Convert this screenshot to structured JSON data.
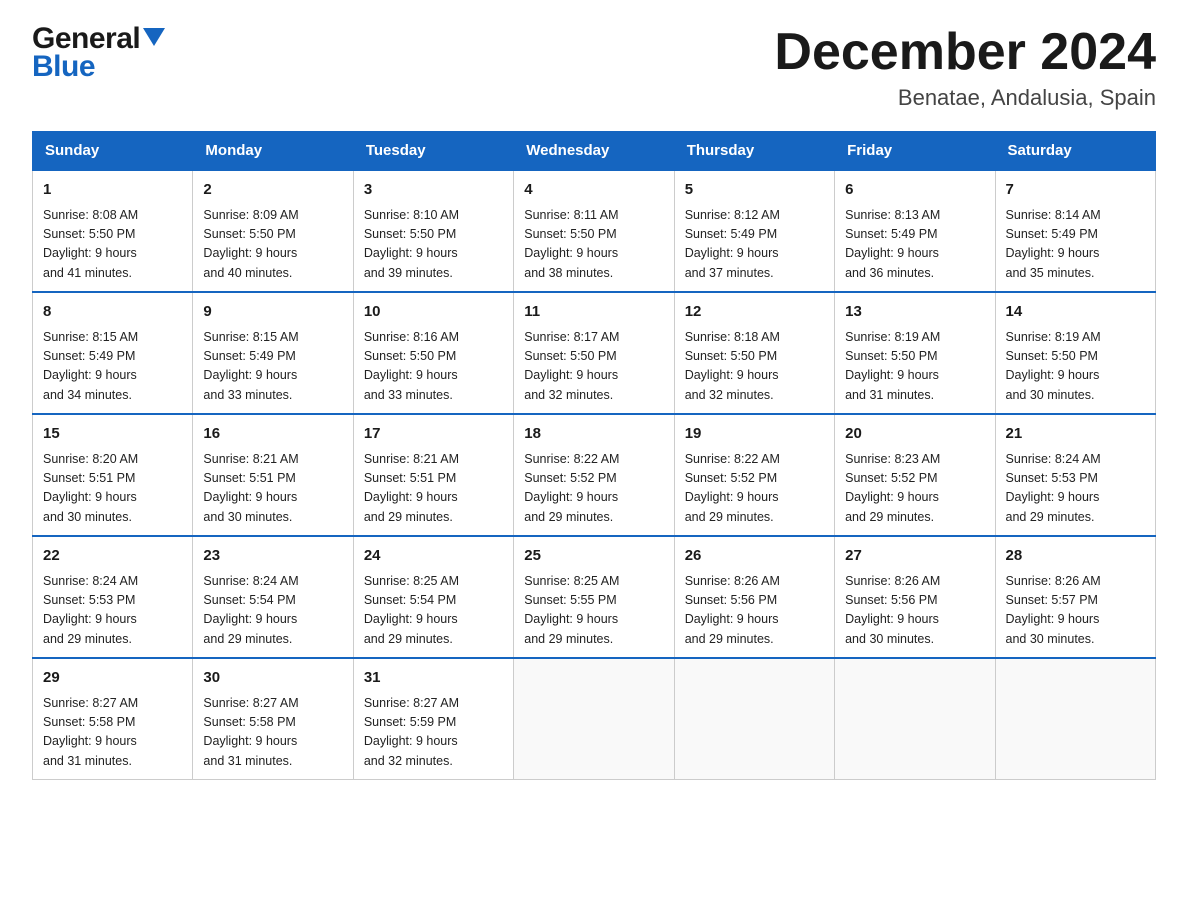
{
  "header": {
    "logo_general": "General",
    "logo_blue": "Blue",
    "month_title": "December 2024",
    "location": "Benatae, Andalusia, Spain"
  },
  "weekdays": [
    "Sunday",
    "Monday",
    "Tuesday",
    "Wednesday",
    "Thursday",
    "Friday",
    "Saturday"
  ],
  "weeks": [
    [
      {
        "day": "1",
        "sunrise": "8:08 AM",
        "sunset": "5:50 PM",
        "daylight": "9 hours and 41 minutes."
      },
      {
        "day": "2",
        "sunrise": "8:09 AM",
        "sunset": "5:50 PM",
        "daylight": "9 hours and 40 minutes."
      },
      {
        "day": "3",
        "sunrise": "8:10 AM",
        "sunset": "5:50 PM",
        "daylight": "9 hours and 39 minutes."
      },
      {
        "day": "4",
        "sunrise": "8:11 AM",
        "sunset": "5:50 PM",
        "daylight": "9 hours and 38 minutes."
      },
      {
        "day": "5",
        "sunrise": "8:12 AM",
        "sunset": "5:49 PM",
        "daylight": "9 hours and 37 minutes."
      },
      {
        "day": "6",
        "sunrise": "8:13 AM",
        "sunset": "5:49 PM",
        "daylight": "9 hours and 36 minutes."
      },
      {
        "day": "7",
        "sunrise": "8:14 AM",
        "sunset": "5:49 PM",
        "daylight": "9 hours and 35 minutes."
      }
    ],
    [
      {
        "day": "8",
        "sunrise": "8:15 AM",
        "sunset": "5:49 PM",
        "daylight": "9 hours and 34 minutes."
      },
      {
        "day": "9",
        "sunrise": "8:15 AM",
        "sunset": "5:49 PM",
        "daylight": "9 hours and 33 minutes."
      },
      {
        "day": "10",
        "sunrise": "8:16 AM",
        "sunset": "5:50 PM",
        "daylight": "9 hours and 33 minutes."
      },
      {
        "day": "11",
        "sunrise": "8:17 AM",
        "sunset": "5:50 PM",
        "daylight": "9 hours and 32 minutes."
      },
      {
        "day": "12",
        "sunrise": "8:18 AM",
        "sunset": "5:50 PM",
        "daylight": "9 hours and 32 minutes."
      },
      {
        "day": "13",
        "sunrise": "8:19 AM",
        "sunset": "5:50 PM",
        "daylight": "9 hours and 31 minutes."
      },
      {
        "day": "14",
        "sunrise": "8:19 AM",
        "sunset": "5:50 PM",
        "daylight": "9 hours and 30 minutes."
      }
    ],
    [
      {
        "day": "15",
        "sunrise": "8:20 AM",
        "sunset": "5:51 PM",
        "daylight": "9 hours and 30 minutes."
      },
      {
        "day": "16",
        "sunrise": "8:21 AM",
        "sunset": "5:51 PM",
        "daylight": "9 hours and 30 minutes."
      },
      {
        "day": "17",
        "sunrise": "8:21 AM",
        "sunset": "5:51 PM",
        "daylight": "9 hours and 29 minutes."
      },
      {
        "day": "18",
        "sunrise": "8:22 AM",
        "sunset": "5:52 PM",
        "daylight": "9 hours and 29 minutes."
      },
      {
        "day": "19",
        "sunrise": "8:22 AM",
        "sunset": "5:52 PM",
        "daylight": "9 hours and 29 minutes."
      },
      {
        "day": "20",
        "sunrise": "8:23 AM",
        "sunset": "5:52 PM",
        "daylight": "9 hours and 29 minutes."
      },
      {
        "day": "21",
        "sunrise": "8:24 AM",
        "sunset": "5:53 PM",
        "daylight": "9 hours and 29 minutes."
      }
    ],
    [
      {
        "day": "22",
        "sunrise": "8:24 AM",
        "sunset": "5:53 PM",
        "daylight": "9 hours and 29 minutes."
      },
      {
        "day": "23",
        "sunrise": "8:24 AM",
        "sunset": "5:54 PM",
        "daylight": "9 hours and 29 minutes."
      },
      {
        "day": "24",
        "sunrise": "8:25 AM",
        "sunset": "5:54 PM",
        "daylight": "9 hours and 29 minutes."
      },
      {
        "day": "25",
        "sunrise": "8:25 AM",
        "sunset": "5:55 PM",
        "daylight": "9 hours and 29 minutes."
      },
      {
        "day": "26",
        "sunrise": "8:26 AM",
        "sunset": "5:56 PM",
        "daylight": "9 hours and 29 minutes."
      },
      {
        "day": "27",
        "sunrise": "8:26 AM",
        "sunset": "5:56 PM",
        "daylight": "9 hours and 30 minutes."
      },
      {
        "day": "28",
        "sunrise": "8:26 AM",
        "sunset": "5:57 PM",
        "daylight": "9 hours and 30 minutes."
      }
    ],
    [
      {
        "day": "29",
        "sunrise": "8:27 AM",
        "sunset": "5:58 PM",
        "daylight": "9 hours and 31 minutes."
      },
      {
        "day": "30",
        "sunrise": "8:27 AM",
        "sunset": "5:58 PM",
        "daylight": "9 hours and 31 minutes."
      },
      {
        "day": "31",
        "sunrise": "8:27 AM",
        "sunset": "5:59 PM",
        "daylight": "9 hours and 32 minutes."
      },
      null,
      null,
      null,
      null
    ]
  ],
  "labels": {
    "sunrise": "Sunrise:",
    "sunset": "Sunset:",
    "daylight": "Daylight:"
  }
}
